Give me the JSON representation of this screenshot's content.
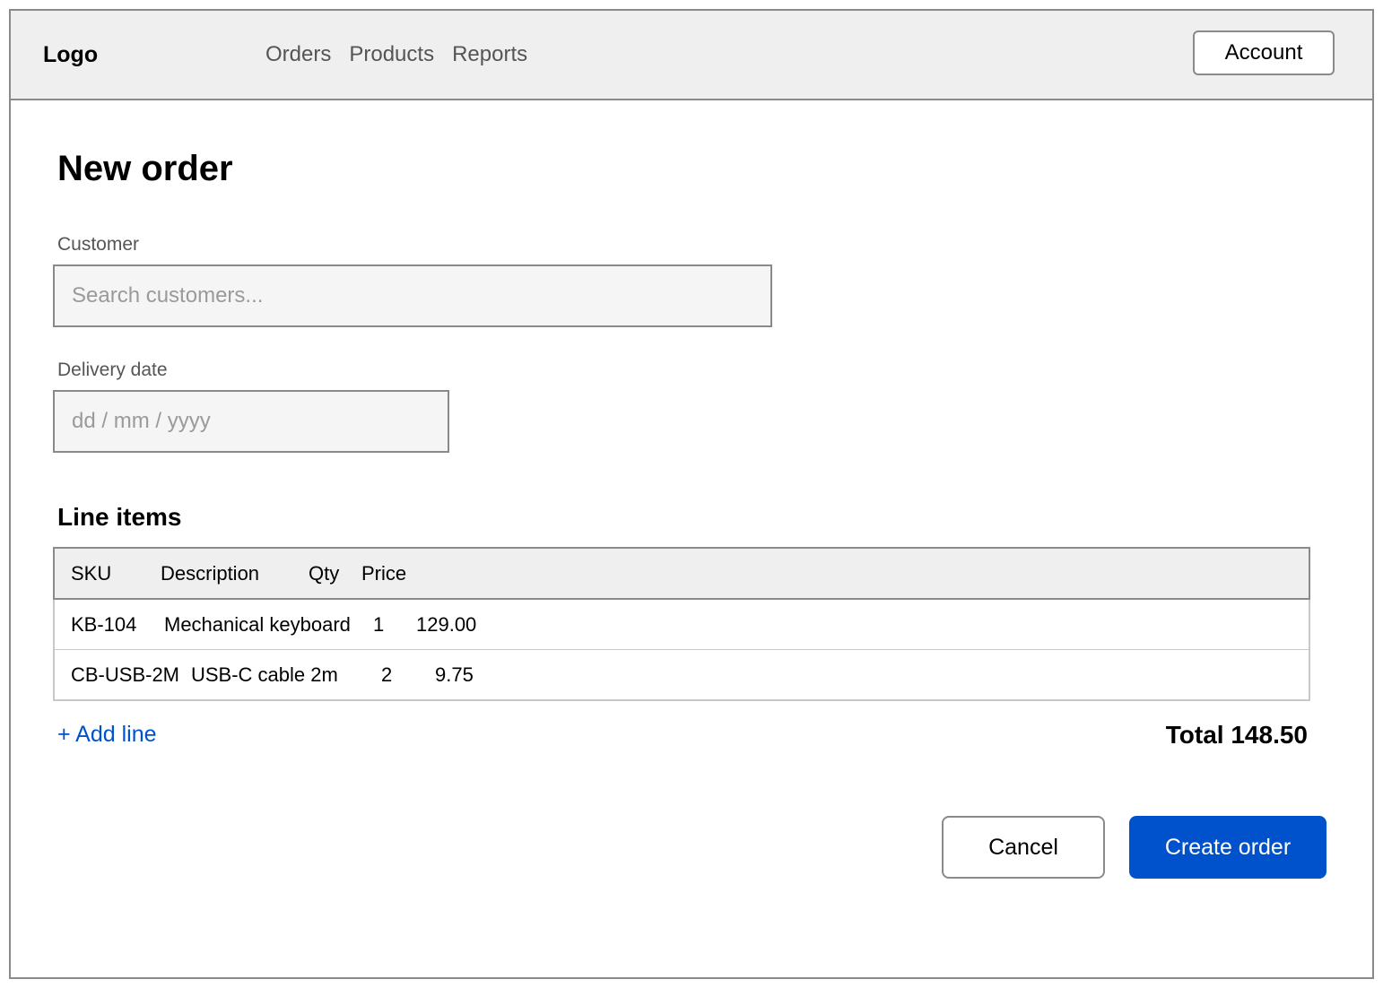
{
  "header": {
    "logo": "Logo",
    "nav": [
      {
        "label": "Orders"
      },
      {
        "label": "Products"
      },
      {
        "label": "Reports"
      }
    ],
    "account_label": "Account"
  },
  "page": {
    "title": "New order"
  },
  "form": {
    "customer": {
      "label": "Customer",
      "placeholder": "Search customers...",
      "value": ""
    },
    "delivery_date": {
      "label": "Delivery date",
      "placeholder": "dd / mm / yyyy",
      "value": ""
    }
  },
  "line_items": {
    "title": "Line items",
    "columns": [
      "SKU",
      "Description",
      "Qty",
      "Price"
    ],
    "rows": [
      {
        "sku": "KB-104",
        "description": "Mechanical keyboard",
        "qty": "1",
        "price": "129.00"
      },
      {
        "sku": "CB-USB-2M",
        "description": "USB-C cable 2m",
        "qty": "2",
        "price": "9.75"
      }
    ],
    "add_line_label": "+ Add line",
    "total_label": "Total 148.50"
  },
  "actions": {
    "cancel_label": "Cancel",
    "create_label": "Create order"
  },
  "colors": {
    "accent": "#0052cc",
    "header_bg": "#efefef",
    "border": "#8a8a8a"
  }
}
